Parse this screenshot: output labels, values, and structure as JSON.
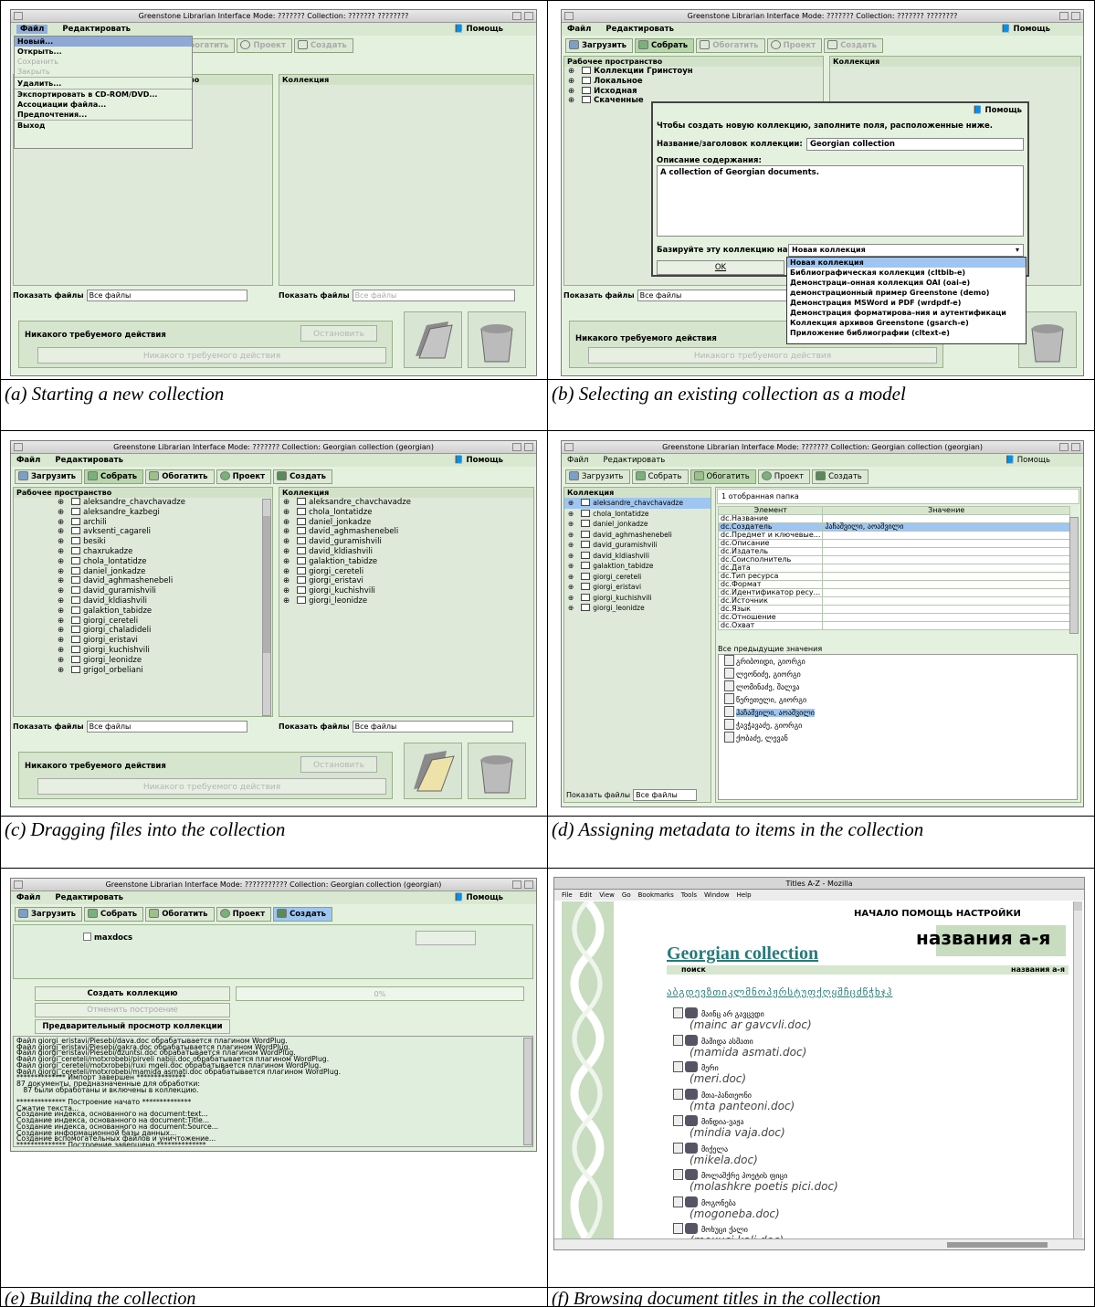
{
  "captions": {
    "a": "(a) Starting a new collection",
    "b": "(b) Selecting an existing collection as a model",
    "c": "(c) Dragging files into the collection",
    "d": "(d) Assigning metadata to items in  the collection",
    "e": "(e) Building the collection",
    "f": "(f) Browsing  document titles in the collection"
  },
  "gli": {
    "title_new": "Greenstone Librarian Interface  Mode: ???????  Collection: ??????? ????????",
    "title_georgian": "Greenstone Librarian Interface  Mode: ???????  Collection: Georgian collection (georgian)",
    "title_e": "Greenstone Librarian Interface  Mode: ???????????  Collection: Georgian collection (georgian)",
    "menu_file": "Файл",
    "menu_edit": "Редактировать",
    "help": "Помощь",
    "tabs": [
      "Загрузить",
      "Собрать",
      "Обогатить",
      "Проект",
      "Создать"
    ],
    "workspace": "Рабочее пространство",
    "collection": "Коллекция",
    "show_files": "Показать файлы",
    "all_files": "Все файлы",
    "no_action": "Никакого требуемого действия",
    "stop": "Остановить"
  },
  "panel_a": {
    "file_menu": [
      "Новый...",
      "Открыть...",
      "Сохранить",
      "Закрыть",
      "Удалить...",
      "Экспортировать в CD-ROM/DVD...",
      "Ассоциации файла...",
      "Предпочтения...",
      "Выход"
    ],
    "partial_tree_text": "тво"
  },
  "panel_b": {
    "tree": [
      "Коллекции Гринстоун",
      "Локальное",
      "Исходная",
      "Скаченные"
    ],
    "intro": "Чтобы создать новую коллекцию, заполните поля, расположенные ниже.",
    "name_label": "Название/заголовок коллекции:",
    "name_value": "Georgian collection",
    "desc_label": "Описание содержания:",
    "desc_value": "A collection of Georgian documents.",
    "base_label": "Базируйте эту коллекцию на:",
    "base_value": "Новая коллекция",
    "ok": "OK",
    "options": [
      "Новая коллекция",
      "Библиографическая коллекция (cltbib-e)",
      "Демонстраци–онная коллекция OAI (oai-e)",
      "демонстрационный пример Greenstone (demo)",
      "Демонстрация MSWord и PDF (wrdpdf-e)",
      "Демонстрация форматирова–ния и аутентификаци",
      "Коллекция архивов Greenstone (gsarch-e)",
      "Приложение библиографии (cltext-e)"
    ]
  },
  "panel_c": {
    "workspace_items": [
      "aleksandre_chavchavadze",
      "aleksandre_kazbegi",
      "archili",
      "avksenti_cagareli",
      "besiki",
      "chaxrukadze",
      "chola_lontatidze",
      "daniel_jonkadze",
      "david_aghmashenebeli",
      "david_guramishvili",
      "david_kldiashvili",
      "galaktion_tabidze",
      "giorgi_cereteli",
      "giorgi_chaladideli",
      "giorgi_eristavi",
      "giorgi_kuchishvili",
      "giorgi_leonidze",
      "grigol_orbeliani"
    ],
    "collection_items": [
      "aleksandre_chavchavadze",
      "chola_lontatidze",
      "daniel_jonkadze",
      "david_aghmashenebeli",
      "david_guramishvili",
      "david_kldiashvili",
      "galaktion_tabidze",
      "giorgi_cereteli",
      "giorgi_eristavi",
      "giorgi_kuchishvili",
      "giorgi_leonidze"
    ]
  },
  "panel_d": {
    "selected_count": "1 отобранная папка",
    "col_element": "Элемент",
    "col_value": "Значение",
    "elements": [
      "dc.Название",
      "dc.Создатель",
      "dc.Предмет и ключевые...",
      "dc.Описание",
      "dc.Издатель",
      "dc.Соисполнитель",
      "dc.Дата",
      "dc.Тип ресурса",
      "dc.Формат",
      "dc.Идентификатор ресу...",
      "dc.Источник",
      "dc.Язык",
      "dc.Отношение",
      "dc.Охват"
    ],
    "creator_value": "ჰაჩაშვილი, აოაშვილი",
    "prev_values_label": "Все предыдущие значения",
    "prev_values": [
      "გრიბოიდი, გიორგი",
      "ლეონიძე, გიორგი",
      "ლომინაძე, შალვა",
      "წერეთელი, გიორგი",
      "ჰაჩაშვილი, აოაშვილი",
      "ჭავჭავაძე, გიორგი",
      "ქობაძე, ლევან"
    ]
  },
  "panel_e": {
    "maxdocs": "maxdocs",
    "build": "Создать коллекцию",
    "cancel": "Отменить построение",
    "preview": "Предварительный просмотр коллекции",
    "progress": "0%",
    "log": [
      "Файл giorgi_eristavi/Piesebi/dava.doc обрабатывается плагином WordPlug.",
      "Файл giorgi_eristavi/Piesebi/gakra.doc обрабатывается плагином WordPlug.",
      "Файл giorgi_eristavi/Piesebi/dzuntsi.doc обрабатывается плагином WordPlug.",
      "Файл giorgi_cereteli/motxrobebi/pirveli nabiji.doc обрабатывается плагином WordPlug.",
      "Файл giorgi_cereteli/motxrobebi/ruxi mgeli.doc обрабатывается плагином WordPlug.",
      "Файл giorgi_cereteli/motxrobebi/mamida asmati.doc обрабатывается плагином WordPlug.",
      "************** Импорт завершен **************",
      "87 документы, предназначенные для обработки:",
      "   87 были обработаны и включены в коллекцию.",
      "",
      "************** Построение начато **************",
      "Сжатие текста...",
      "Создание индекса, основанного на document:text...",
      "Создание индекса, основанного на document:Title...",
      "Создание индекса, основанного на document:Source...",
      "Создание информационной базы данных...",
      "Создание вспомогательных файлов и уничтожение...",
      "************** Построение завершено **************"
    ]
  },
  "panel_f": {
    "title": "Titles A-Z - Mozilla",
    "menu": [
      "File",
      "Edit",
      "View",
      "Go",
      "Bookmarks",
      "Tools",
      "Window",
      "Help"
    ],
    "top_links": "НАЧАЛО ПОМОЩЬ НАСТРОЙКИ",
    "heading": "названия а-я",
    "collection_name": "Georgian collection",
    "search": "поиск",
    "titles_az": "названия а-я",
    "alphabet": "აბგდევზთიკლმნოპჟრსტუფქღყშჩცძწჭხჯჰ",
    "docs": [
      {
        "ka": "მაინც არ გავცვდი",
        "file": "(mainc ar gavcvli.doc)"
      },
      {
        "ka": "მამიდა ასმათი",
        "file": "(mamida asmati.doc)"
      },
      {
        "ka": "მერი",
        "file": "(meri.doc)"
      },
      {
        "ka": "მთა-პანთეონი",
        "file": "(mta panteoni.doc)"
      },
      {
        "ka": "მინდია-ვაჟა",
        "file": "(mindia vaja.doc)"
      },
      {
        "ka": "მიქელა",
        "file": "(mikela.doc)"
      },
      {
        "ka": "მოლაშქრე პოეტის ფიცი",
        "file": "(molashkre poetis pici.doc)"
      },
      {
        "ka": "მოგონება",
        "file": "(mogoneba.doc)"
      },
      {
        "ka": "მოხუცი ქალი",
        "file": "(moxuci kali.doc)"
      }
    ]
  }
}
